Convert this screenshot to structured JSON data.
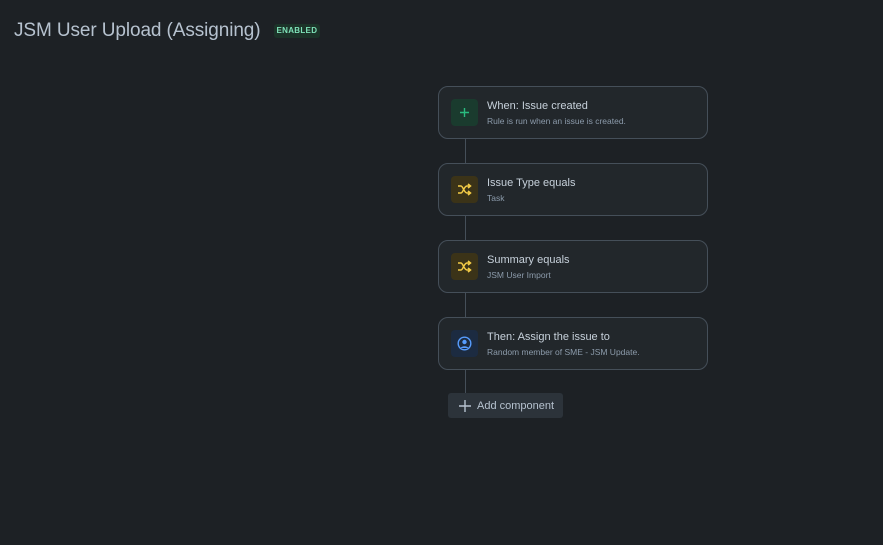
{
  "header": {
    "title": "JSM User Upload (Assigning)",
    "status": "ENABLED"
  },
  "rule": {
    "components": [
      {
        "type": "trigger",
        "icon": "plus-icon",
        "title": "When: Issue created",
        "subtitle": "Rule is run when an issue is created."
      },
      {
        "type": "condition",
        "icon": "shuffle-icon",
        "title": "Issue Type equals",
        "subtitle": "Task"
      },
      {
        "type": "condition",
        "icon": "shuffle-icon",
        "title": "Summary equals",
        "subtitle": "JSM User Import"
      },
      {
        "type": "action",
        "icon": "user-circle-icon",
        "title": "Then: Assign the issue to",
        "subtitle": "Random member of SME - JSM Update."
      }
    ],
    "add_component_label": "Add component"
  },
  "colors": {
    "background": "#1d2125",
    "trigger_accent": "#2abb7f",
    "condition_accent": "#f5cd47",
    "action_accent": "#579dff",
    "badge_text": "#7ee2b8"
  }
}
